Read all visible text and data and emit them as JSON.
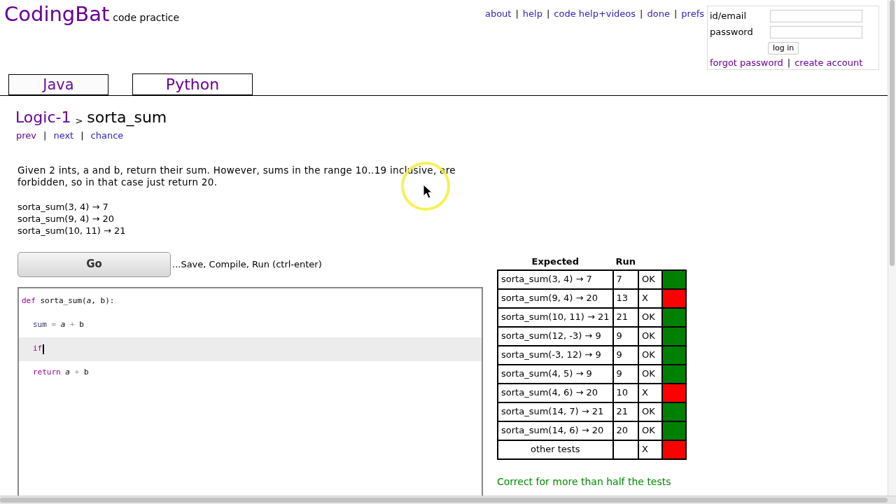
{
  "logo": {
    "name": "CodingBat",
    "tagline": "code practice"
  },
  "top_links": [
    {
      "kind": "link",
      "text": "about"
    },
    {
      "kind": "separator",
      "text": "|"
    },
    {
      "kind": "link",
      "text": "help"
    },
    {
      "kind": "separator",
      "text": "|"
    },
    {
      "kind": "link",
      "text": "code help+videos"
    },
    {
      "kind": "separator",
      "text": "|"
    },
    {
      "kind": "link",
      "text": "done"
    },
    {
      "kind": "separator",
      "text": "|"
    },
    {
      "kind": "link",
      "text": "prefs"
    }
  ],
  "login": {
    "email_label": "id/email",
    "password_label": "password",
    "button": "log in",
    "links": [
      {
        "kind": "link",
        "text": "forgot password"
      },
      {
        "kind": "separator",
        "text": "|"
      },
      {
        "kind": "link",
        "text": "create account"
      }
    ]
  },
  "tabs": [
    {
      "label": "Java",
      "selected": false
    },
    {
      "label": "Python",
      "selected": true
    }
  ],
  "breadcrumb": {
    "section": "Logic-1",
    "separator": ">",
    "problem": "sorta_sum"
  },
  "nav_links": [
    {
      "kind": "link",
      "text": "prev"
    },
    {
      "kind": "separator",
      "text": "|"
    },
    {
      "kind": "link",
      "text": "next"
    },
    {
      "kind": "separator",
      "text": "|"
    },
    {
      "kind": "link",
      "text": "chance"
    }
  ],
  "description": "Given 2 ints, a and b, return their sum. However, sums in the range 10..19 inclusive, are forbidden, so in that case just return 20.",
  "examples": [
    "sorta_sum(3, 4) → 7",
    "sorta_sum(9, 4) → 20",
    "sorta_sum(10, 11) → 21"
  ],
  "go_button": "Go",
  "go_hint": "...Save, Compile, Run (ctrl-enter)",
  "editor": {
    "lines": [
      {
        "indent": false,
        "active": false,
        "tokens": [
          {
            "text": "def",
            "kind": "keyword"
          },
          {
            "text": " sorta_sum(",
            "kind": "plain"
          },
          {
            "text": "a",
            "kind": "param"
          },
          {
            "text": ", b):",
            "kind": "plain"
          }
        ]
      },
      {
        "indent": true,
        "active": false,
        "tokens": [
          {
            "text": "sum",
            "kind": "name"
          },
          {
            "text": " = ",
            "kind": "op"
          },
          {
            "text": "a",
            "kind": "param"
          },
          {
            "text": " + ",
            "kind": "op"
          },
          {
            "text": "b",
            "kind": "plain"
          }
        ]
      },
      {
        "indent": true,
        "active": true,
        "tokens": [
          {
            "text": "if",
            "kind": "keyword"
          }
        ]
      },
      {
        "indent": true,
        "active": false,
        "tokens": [
          {
            "text": "return",
            "kind": "keyword"
          },
          {
            "text": " a",
            "kind": "param"
          },
          {
            "text": " + ",
            "kind": "op"
          },
          {
            "text": "b",
            "kind": "plain"
          }
        ]
      }
    ]
  },
  "results": {
    "columns": [
      "Expected",
      "Run"
    ],
    "rows": [
      {
        "expected": "sorta_sum(3, 4) → 7",
        "run": "7",
        "verdict": "OK",
        "color": "#008000"
      },
      {
        "expected": "sorta_sum(9, 4) → 20",
        "run": "13",
        "verdict": "X",
        "color": "#ff0000"
      },
      {
        "expected": "sorta_sum(10, 11) → 21",
        "run": "21",
        "verdict": "OK",
        "color": "#008000"
      },
      {
        "expected": "sorta_sum(12, -3) → 9",
        "run": "9",
        "verdict": "OK",
        "color": "#008000"
      },
      {
        "expected": "sorta_sum(-3, 12) → 9",
        "run": "9",
        "verdict": "OK",
        "color": "#008000"
      },
      {
        "expected": "sorta_sum(4, 5) → 9",
        "run": "9",
        "verdict": "OK",
        "color": "#008000"
      },
      {
        "expected": "sorta_sum(4, 6) → 20",
        "run": "10",
        "verdict": "X",
        "color": "#ff0000"
      },
      {
        "expected": "sorta_sum(14, 7) → 21",
        "run": "21",
        "verdict": "OK",
        "color": "#008000"
      },
      {
        "expected": "sorta_sum(14, 6) → 20",
        "run": "20",
        "verdict": "OK",
        "color": "#008000"
      },
      {
        "expected": "other tests",
        "verdict": "X",
        "color": "#ff0000"
      }
    ],
    "summary": "Correct for more than half the tests"
  }
}
